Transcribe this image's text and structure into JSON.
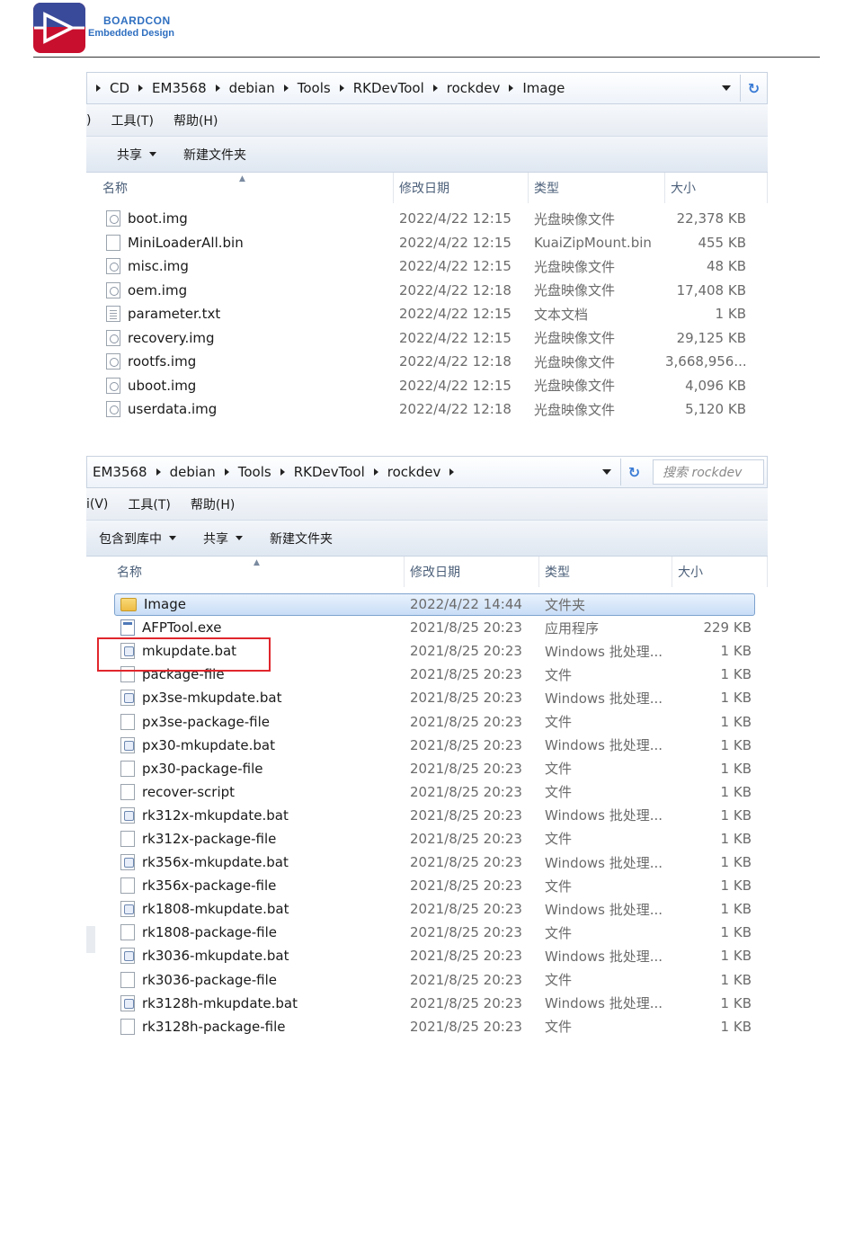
{
  "brand": {
    "line1": "BOARDCON",
    "line2": "Embedded Design"
  },
  "panel1": {
    "breadcrumbs": [
      "CD",
      "EM3568",
      "debian",
      "Tools",
      "RKDevTool",
      "rockdev",
      "Image"
    ],
    "menu": [
      ")",
      "工具(T)",
      "帮助(H)"
    ],
    "toolbar": [
      {
        "label": "共享",
        "dropdown": true
      },
      {
        "label": "新建文件夹",
        "dropdown": false
      }
    ],
    "columns": [
      "名称",
      "修改日期",
      "类型",
      "大小"
    ],
    "files": [
      {
        "name": "boot.img",
        "date": "2022/4/22 12:15",
        "type": "光盘映像文件",
        "size": "22,378 KB",
        "icon": "disc"
      },
      {
        "name": "MiniLoaderAll.bin",
        "date": "2022/4/22 12:15",
        "type": "KuaiZipMount.bin",
        "size": "455 KB",
        "icon": "blank"
      },
      {
        "name": "misc.img",
        "date": "2022/4/22 12:15",
        "type": "光盘映像文件",
        "size": "48 KB",
        "icon": "disc"
      },
      {
        "name": "oem.img",
        "date": "2022/4/22 12:18",
        "type": "光盘映像文件",
        "size": "17,408 KB",
        "icon": "disc"
      },
      {
        "name": "parameter.txt",
        "date": "2022/4/22 12:15",
        "type": "文本文档",
        "size": "1 KB",
        "icon": "text"
      },
      {
        "name": "recovery.img",
        "date": "2022/4/22 12:15",
        "type": "光盘映像文件",
        "size": "29,125 KB",
        "icon": "disc"
      },
      {
        "name": "rootfs.img",
        "date": "2022/4/22 12:18",
        "type": "光盘映像文件",
        "size": "3,668,956...",
        "icon": "disc"
      },
      {
        "name": "uboot.img",
        "date": "2022/4/22 12:15",
        "type": "光盘映像文件",
        "size": "4,096 KB",
        "icon": "disc"
      },
      {
        "name": "userdata.img",
        "date": "2022/4/22 12:18",
        "type": "光盘映像文件",
        "size": "5,120 KB",
        "icon": "disc"
      }
    ]
  },
  "panel2": {
    "breadcrumbs": [
      "EM3568",
      "debian",
      "Tools",
      "RKDevTool",
      "rockdev"
    ],
    "search_placeholder": "搜索 rockdev",
    "menu": [
      "i(V)",
      "工具(T)",
      "帮助(H)"
    ],
    "toolbar": [
      {
        "label": "包含到库中",
        "dropdown": true
      },
      {
        "label": "共享",
        "dropdown": true
      },
      {
        "label": "新建文件夹",
        "dropdown": false
      }
    ],
    "columns": [
      "名称",
      "修改日期",
      "类型",
      "大小"
    ],
    "files": [
      {
        "name": "Image",
        "date": "2022/4/22 14:44",
        "type": "文件夹",
        "size": "",
        "icon": "folder",
        "selected": true
      },
      {
        "name": "AFPTool.exe",
        "date": "2021/8/25 20:23",
        "type": "应用程序",
        "size": "229 KB",
        "icon": "exe"
      },
      {
        "name": "mkupdate.bat",
        "date": "2021/8/25 20:23",
        "type": "Windows 批处理...",
        "size": "1 KB",
        "icon": "bat"
      },
      {
        "name": "package-file",
        "date": "2021/8/25 20:23",
        "type": "文件",
        "size": "1 KB",
        "icon": "blank"
      },
      {
        "name": "px3se-mkupdate.bat",
        "date": "2021/8/25 20:23",
        "type": "Windows 批处理...",
        "size": "1 KB",
        "icon": "bat"
      },
      {
        "name": "px3se-package-file",
        "date": "2021/8/25 20:23",
        "type": "文件",
        "size": "1 KB",
        "icon": "blank"
      },
      {
        "name": "px30-mkupdate.bat",
        "date": "2021/8/25 20:23",
        "type": "Windows 批处理...",
        "size": "1 KB",
        "icon": "bat"
      },
      {
        "name": "px30-package-file",
        "date": "2021/8/25 20:23",
        "type": "文件",
        "size": "1 KB",
        "icon": "blank"
      },
      {
        "name": "recover-script",
        "date": "2021/8/25 20:23",
        "type": "文件",
        "size": "1 KB",
        "icon": "blank"
      },
      {
        "name": "rk312x-mkupdate.bat",
        "date": "2021/8/25 20:23",
        "type": "Windows 批处理...",
        "size": "1 KB",
        "icon": "bat"
      },
      {
        "name": "rk312x-package-file",
        "date": "2021/8/25 20:23",
        "type": "文件",
        "size": "1 KB",
        "icon": "blank"
      },
      {
        "name": "rk356x-mkupdate.bat",
        "date": "2021/8/25 20:23",
        "type": "Windows 批处理...",
        "size": "1 KB",
        "icon": "bat"
      },
      {
        "name": "rk356x-package-file",
        "date": "2021/8/25 20:23",
        "type": "文件",
        "size": "1 KB",
        "icon": "blank"
      },
      {
        "name": "rk1808-mkupdate.bat",
        "date": "2021/8/25 20:23",
        "type": "Windows 批处理...",
        "size": "1 KB",
        "icon": "bat"
      },
      {
        "name": "rk1808-package-file",
        "date": "2021/8/25 20:23",
        "type": "文件",
        "size": "1 KB",
        "icon": "blank"
      },
      {
        "name": "rk3036-mkupdate.bat",
        "date": "2021/8/25 20:23",
        "type": "Windows 批处理...",
        "size": "1 KB",
        "icon": "bat"
      },
      {
        "name": "rk3036-package-file",
        "date": "2021/8/25 20:23",
        "type": "文件",
        "size": "1 KB",
        "icon": "blank"
      },
      {
        "name": "rk3128h-mkupdate.bat",
        "date": "2021/8/25 20:23",
        "type": "Windows 批处理...",
        "size": "1 KB",
        "icon": "bat"
      },
      {
        "name": "rk3128h-package-file",
        "date": "2021/8/25 20:23",
        "type": "文件",
        "size": "1 KB",
        "icon": "blank"
      }
    ]
  },
  "colors": {
    "highlight": "#e0262c",
    "brand": "#2f6fc0",
    "selection": "#c8ddf6"
  }
}
